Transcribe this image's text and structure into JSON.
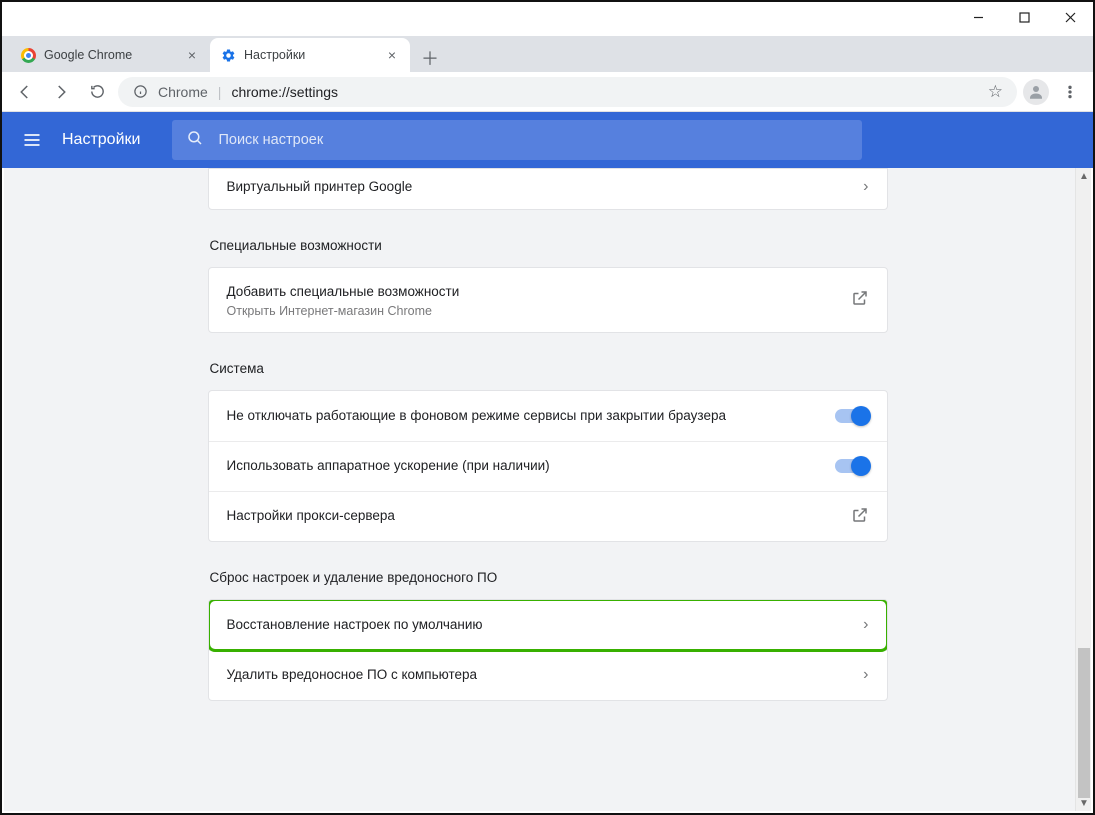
{
  "window": {
    "tabs": [
      {
        "title": "Google Chrome",
        "active": false
      },
      {
        "title": "Настройки",
        "active": true
      }
    ]
  },
  "omnibox": {
    "origin": "Chrome",
    "path": "chrome://settings"
  },
  "header": {
    "title": "Настройки",
    "search_placeholder": "Поиск настроек"
  },
  "sections": {
    "printer_stub": {
      "row": "Виртуальный принтер Google"
    },
    "accessibility": {
      "label": "Специальные возможности",
      "row_primary": "Добавить специальные возможности",
      "row_secondary": "Открыть Интернет-магазин Chrome"
    },
    "system": {
      "label": "Система",
      "row1": "Не отключать работающие в фоновом режиме сервисы при закрытии браузера",
      "row2": "Использовать аппаратное ускорение (при наличии)",
      "row3": "Настройки прокси-сервера"
    },
    "reset": {
      "label": "Сброс настроек и удаление вредоносного ПО",
      "row1": "Восстановление настроек по умолчанию",
      "row2": "Удалить вредоносное ПО с компьютера"
    }
  }
}
